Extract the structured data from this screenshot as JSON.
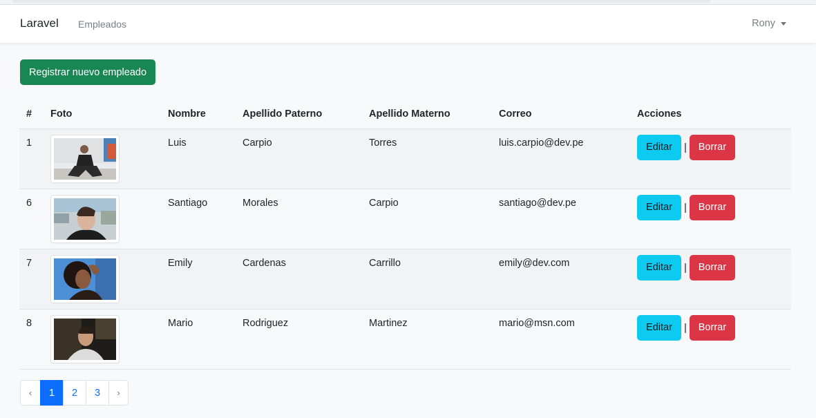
{
  "navbar": {
    "brand": "Laravel",
    "link": "Empleados",
    "user": "Rony"
  },
  "actions": {
    "new_employee": "Registrar nuevo empleado"
  },
  "table": {
    "headers": [
      "#",
      "Foto",
      "Nombre",
      "Apellido Paterno",
      "Apellido Materno",
      "Correo",
      "Acciones"
    ],
    "rows": [
      {
        "id": "1",
        "nombre": "Luis",
        "paterno": "Carpio",
        "materno": "Torres",
        "correo": "luis.carpio@dev.pe",
        "edit": "Editar",
        "sep": "|",
        "delete": "Borrar"
      },
      {
        "id": "6",
        "nombre": "Santiago",
        "paterno": "Morales",
        "materno": "Carpio",
        "correo": "santiago@dev.pe",
        "edit": "Editar",
        "sep": "|",
        "delete": "Borrar"
      },
      {
        "id": "7",
        "nombre": "Emily",
        "paterno": "Cardenas",
        "materno": "Carrillo",
        "correo": "emily@dev.com",
        "edit": "Editar",
        "sep": "|",
        "delete": "Borrar"
      },
      {
        "id": "8",
        "nombre": "Mario",
        "paterno": "Rodriguez",
        "materno": "Martinez",
        "correo": "mario@msn.com",
        "edit": "Editar",
        "sep": "|",
        "delete": "Borrar"
      }
    ]
  },
  "pagination": {
    "prev": "‹",
    "pages": [
      "1",
      "2",
      "3"
    ],
    "active": "1",
    "next": "›"
  },
  "colors": {
    "success": "#198754",
    "info": "#0dcaf0",
    "danger": "#dc3545",
    "primary": "#0d6efd"
  }
}
